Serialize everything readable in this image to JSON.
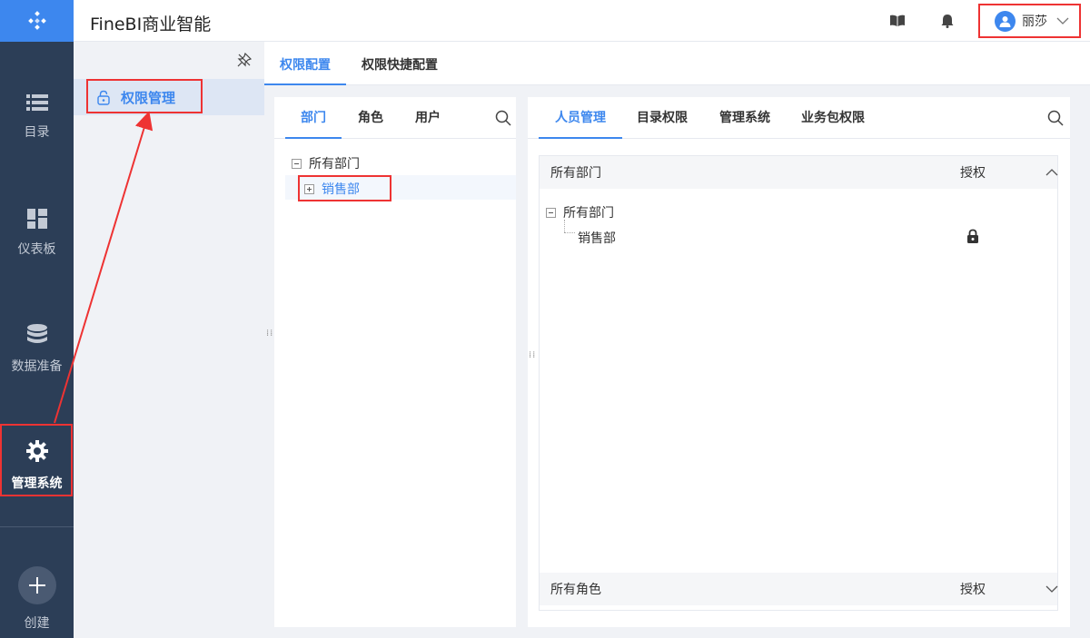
{
  "app": {
    "title": "FineBI商业智能"
  },
  "nav": {
    "items": [
      {
        "label": "目录",
        "icon": "list-icon"
      },
      {
        "label": "仪表板",
        "icon": "dashboard-icon"
      },
      {
        "label": "数据准备",
        "icon": "database-icon"
      },
      {
        "label": "管理系统",
        "icon": "gear-icon",
        "active": true
      }
    ],
    "create_label": "创建"
  },
  "header": {
    "user_name": "丽莎"
  },
  "subpanel": {
    "item_label": "权限管理"
  },
  "top_tabs": [
    {
      "label": "权限配置",
      "active": true
    },
    {
      "label": "权限快捷配置"
    }
  ],
  "left_card": {
    "tabs": [
      {
        "label": "部门",
        "active": true
      },
      {
        "label": "角色"
      },
      {
        "label": "用户"
      }
    ],
    "tree": {
      "root": "所有部门",
      "child": "销售部"
    }
  },
  "right_card": {
    "tabs": [
      {
        "label": "人员管理",
        "active": true
      },
      {
        "label": "目录权限"
      },
      {
        "label": "管理系统"
      },
      {
        "label": "业务包权限"
      }
    ],
    "section1": {
      "title": "所有部门",
      "auth_label": "授权"
    },
    "tree": {
      "root": "所有部门",
      "child": "销售部"
    },
    "section2": {
      "title": "所有角色",
      "auth_label": "授权"
    }
  },
  "colors": {
    "accent": "#3d87ee",
    "nav_bg": "#2c3e57",
    "annotation": "#ee3333"
  }
}
